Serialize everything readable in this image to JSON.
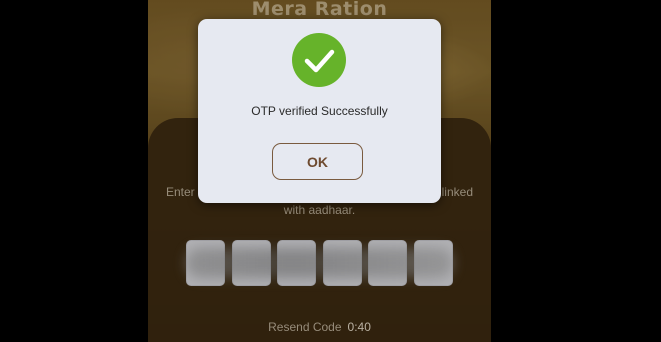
{
  "app": {
    "title": "Mera Ration"
  },
  "otp_screen": {
    "instruction_left": "Enter",
    "instruction_right": "linked",
    "instruction_line2": "with aadhaar.",
    "otp_box_count": 6,
    "resend_label": "Resend Code",
    "resend_timer": "0:40"
  },
  "dialog": {
    "icon": "check-circle-icon",
    "message": "OTP verified Successfully",
    "ok_label": "OK"
  },
  "colors": {
    "success_green": "#66b32a",
    "dialog_bg": "#e6e9f1",
    "ok_text": "#6e4a2f",
    "card_bg": "#3b2a12"
  }
}
